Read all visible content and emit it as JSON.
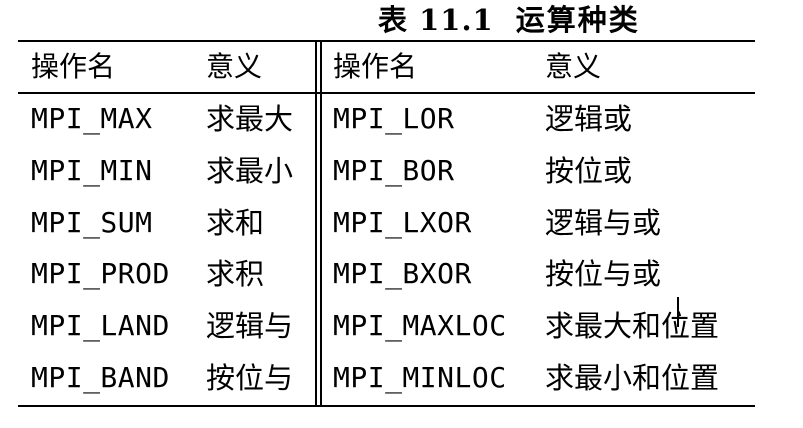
{
  "caption": {
    "label": "表 11.1",
    "title": "运算种类"
  },
  "headers": {
    "left_name": "操作名",
    "left_meaning": "意义",
    "right_name": "操作名",
    "right_meaning": "意义"
  },
  "rows": [
    {
      "left_op": "MPI_MAX",
      "left_meaning": "求最大",
      "right_op": "MPI_LOR",
      "right_meaning": "逻辑或"
    },
    {
      "left_op": "MPI_MIN",
      "left_meaning": "求最小",
      "right_op": "MPI_BOR",
      "right_meaning": "按位或"
    },
    {
      "left_op": "MPI_SUM",
      "left_meaning": "求和",
      "right_op": "MPI_LXOR",
      "right_meaning": "逻辑与或"
    },
    {
      "left_op": "MPI_PROD",
      "left_meaning": "求积",
      "right_op": "MPI_BXOR",
      "right_meaning": "按位与或"
    },
    {
      "left_op": "MPI_LAND",
      "left_meaning": "逻辑与",
      "right_op": "MPI_MAXLOC",
      "right_meaning": "求最大和位置"
    },
    {
      "left_op": "MPI_BAND",
      "left_meaning": "按位与",
      "right_op": "MPI_MINLOC",
      "right_meaning": "求最小和位置"
    }
  ]
}
